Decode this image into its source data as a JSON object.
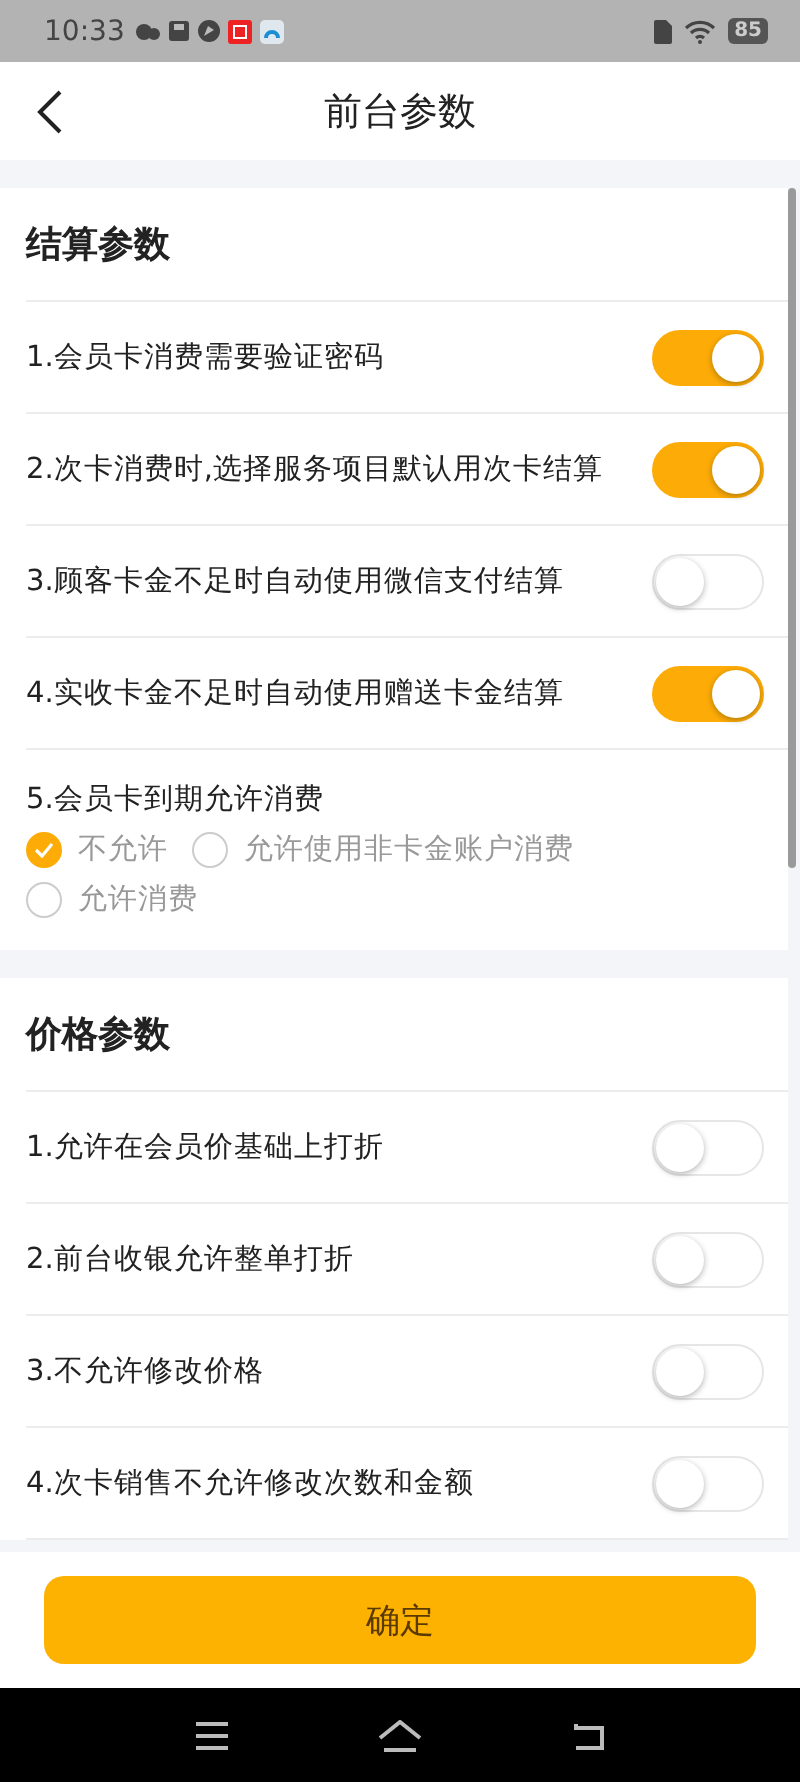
{
  "status_bar": {
    "time": "10:33",
    "battery": "85"
  },
  "header": {
    "title": "前台参数"
  },
  "sections": [
    {
      "title": "结算参数",
      "items": [
        {
          "kind": "switch",
          "label": "1.会员卡消费需要验证密码",
          "on": true
        },
        {
          "kind": "switch",
          "label": "2.次卡消费时,选择服务项目默认用次卡结算",
          "on": true
        },
        {
          "kind": "switch",
          "label": "3.顾客卡金不足时自动使用微信支付结算",
          "on": false
        },
        {
          "kind": "switch",
          "label": "4.实收卡金不足时自动使用赠送卡金结算",
          "on": true
        },
        {
          "kind": "radio",
          "label": "5.会员卡到期允许消费",
          "options": [
            {
              "label": "不允许",
              "selected": true
            },
            {
              "label": "允许使用非卡金账户消费",
              "selected": false
            },
            {
              "label": "允许消费",
              "selected": false
            }
          ]
        }
      ]
    },
    {
      "title": "价格参数",
      "items": [
        {
          "kind": "switch",
          "label": "1.允许在会员价基础上打折",
          "on": false
        },
        {
          "kind": "switch",
          "label": "2.前台收银允许整单打折",
          "on": false
        },
        {
          "kind": "switch",
          "label": "3.不允许修改价格",
          "on": false
        },
        {
          "kind": "switch",
          "label": "4.次卡销售不允许修改次数和金额",
          "on": false
        }
      ]
    }
  ],
  "confirm_button": "确定"
}
